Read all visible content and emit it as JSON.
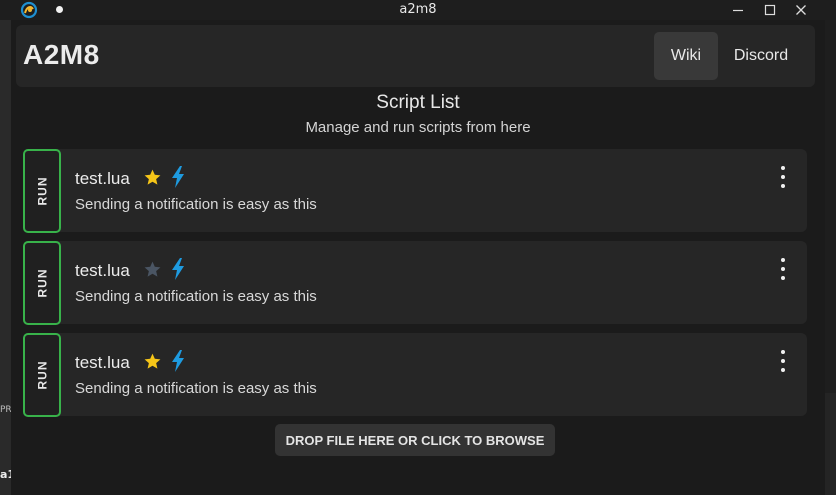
{
  "window": {
    "title": "a2m8"
  },
  "background": {
    "fragment_left": "PR",
    "fragment_bottom": "a1"
  },
  "header": {
    "brand": "A2M8",
    "nav": [
      {
        "label": "Wiki",
        "active": true
      },
      {
        "label": "Discord",
        "active": false
      }
    ]
  },
  "main": {
    "title": "Script List",
    "subtitle": "Manage and run scripts from here",
    "scripts": [
      {
        "run_label": "RUN",
        "name": "test.lua",
        "description": "Sending a notification is easy as this",
        "favorite": true,
        "has_bolt": true
      },
      {
        "run_label": "RUN",
        "name": "test.lua",
        "description": "Sending a notification is easy as this",
        "favorite": false,
        "has_bolt": true
      },
      {
        "run_label": "RUN",
        "name": "test.lua",
        "description": "Sending a notification is easy as this",
        "favorite": true,
        "has_bolt": true
      }
    ],
    "drop_label": "DROP FILE HERE OR CLICK TO BROWSE"
  },
  "icons": {
    "app": "a2m8-logo-icon",
    "star": "star-icon",
    "bolt": "lightning-bolt-icon",
    "more": "kebab-menu-icon"
  },
  "colors": {
    "run_border": "#38b24a",
    "star_active": "#f5c518",
    "star_inactive": "#4a5563",
    "bolt": "#1e9be0"
  }
}
